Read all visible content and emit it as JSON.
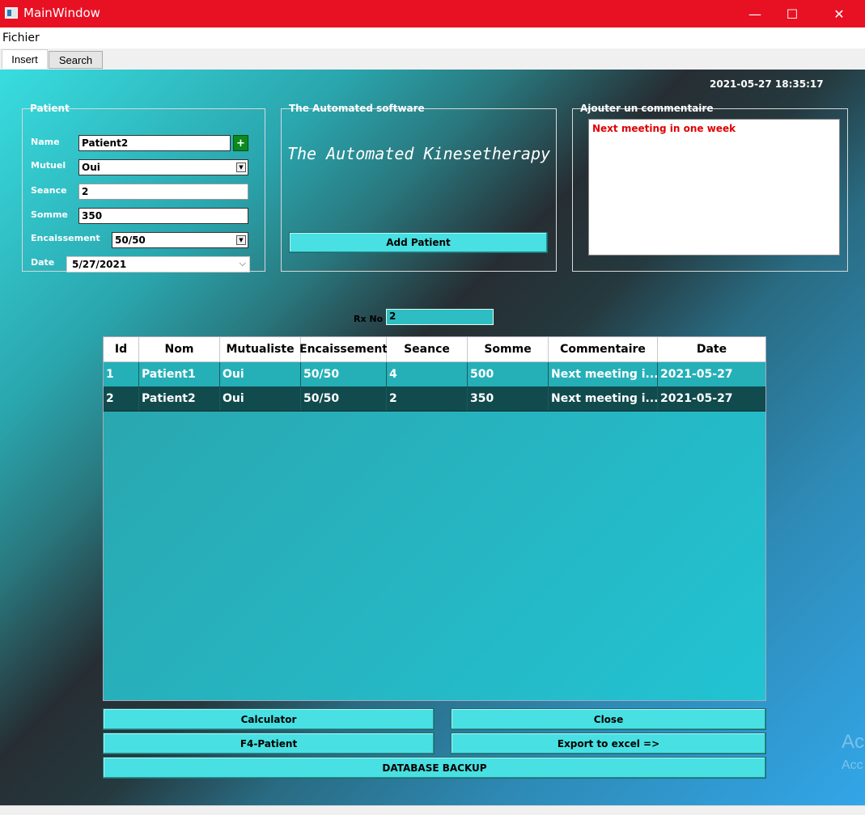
{
  "window": {
    "title": "MainWindow",
    "controls": {
      "minimize": "—",
      "maximize": "☐",
      "close": "✕"
    },
    "accent_color": "#e81123"
  },
  "menu": {
    "items": [
      "Fichier"
    ]
  },
  "tabs": [
    {
      "label": "Insert",
      "active": true
    },
    {
      "label": "Search",
      "active": false
    }
  ],
  "datetime": "2021-05-27 18:35:17",
  "patient_group": {
    "title": "Patient",
    "name_label": "Name",
    "name_value": "Patient2",
    "add_symbol": "+",
    "mutuel_label": "Mutuel",
    "mutuel_value": "Oui",
    "seance_label": "Seance",
    "seance_value": "2",
    "somme_label": "Somme",
    "somme_value": "350",
    "encaissement_label": "Encaissement",
    "encaissement_value": "50/50",
    "date_label": "Date",
    "date_value": "5/27/2021"
  },
  "software_group": {
    "title": "The Automated software",
    "heading": "The Automated Kinesetherapy",
    "add_button": "Add Patient"
  },
  "comment_group": {
    "title": "Ajouter un commentaire",
    "text": "Next meeting in one week",
    "text_color": "#e00000"
  },
  "rx": {
    "label": "Rx No",
    "value": "2"
  },
  "table": {
    "columns": [
      "Id",
      "Nom",
      "Mutualiste",
      "Encaissement",
      "Seance",
      "Somme",
      "Commentaire",
      "Date"
    ],
    "rows": [
      [
        "1",
        "Patient1",
        "Oui",
        "50/50",
        "4",
        "500",
        "Next meeting i...",
        "2021-05-27"
      ],
      [
        "2",
        "Patient2",
        "Oui",
        "50/50",
        "2",
        "350",
        "Next meeting i...",
        "2021-05-27"
      ]
    ],
    "selected_row": 2
  },
  "buttons": {
    "calculator": "Calculator",
    "close": "Close",
    "f4_patient": "F4-Patient",
    "export": "Export to excel =>",
    "backup": "DATABASE BACKUP"
  },
  "watermark": {
    "line1": "Ac",
    "line2": "Acc"
  }
}
